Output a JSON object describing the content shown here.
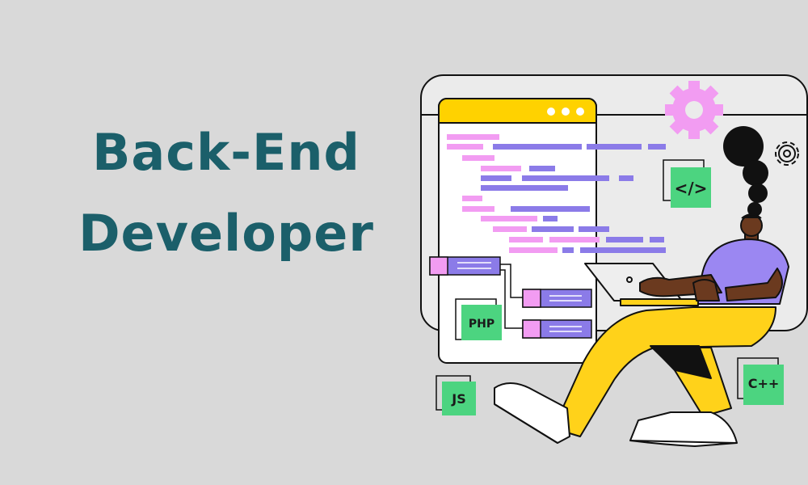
{
  "heading": {
    "line1": "Back-End",
    "line2": "Developer"
  },
  "badges": {
    "code_tag": "</>",
    "php": "PHP",
    "js": "JS",
    "cpp": "C++"
  },
  "colors": {
    "background": "#d9d9d9",
    "heading": "#1b5f6a",
    "editor_bar": "#ffd200",
    "code_pink": "#f29cf2",
    "code_purple": "#8b7be8",
    "badge_green": "#4cd480",
    "pants": "#ffd21a",
    "shirt": "#9b87f2",
    "gear_pink": "#f29cf2"
  },
  "icons": [
    "gear-icon",
    "gear-outline-icon",
    "code-tag-icon",
    "window-dots-icon",
    "laptop-icon"
  ]
}
